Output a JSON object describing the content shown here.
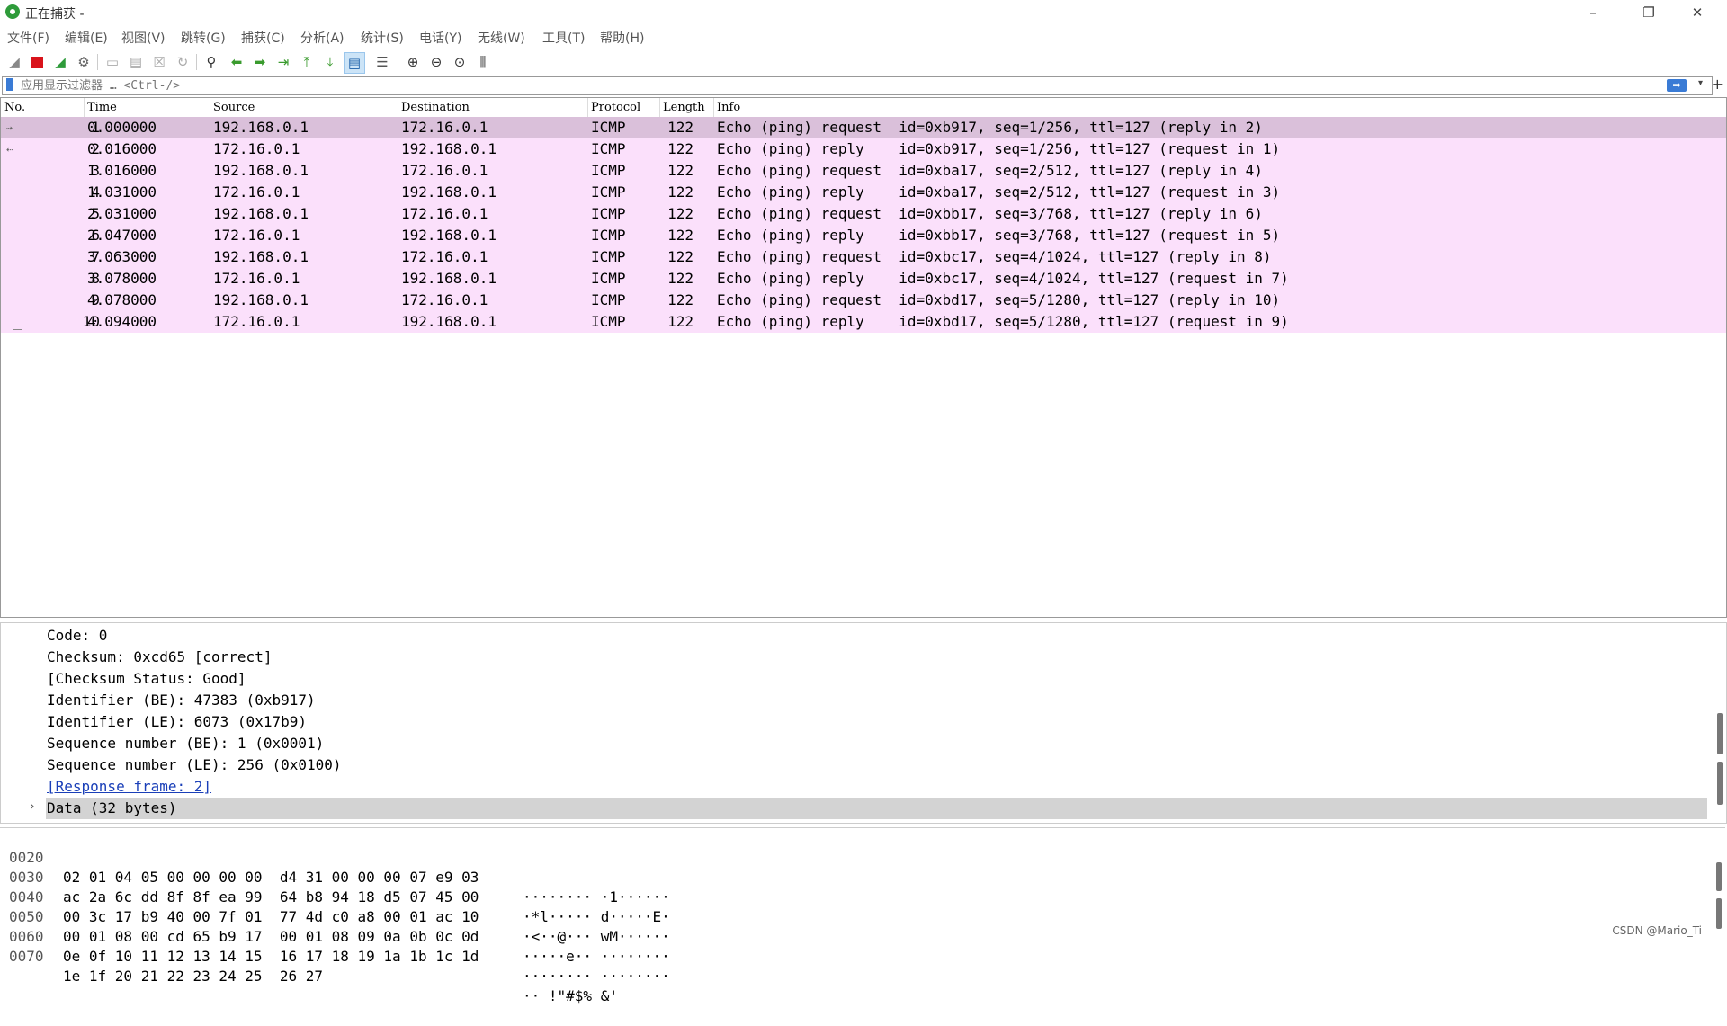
{
  "window": {
    "title": "正在捕获 -",
    "minimize": "–",
    "restore": "❐",
    "close": "✕"
  },
  "menu": [
    "文件(F)",
    "编辑(E)",
    "视图(V)",
    "跳转(G)",
    "捕获(C)",
    "分析(A)",
    "统计(S)",
    "电话(Y)",
    "无线(W)",
    "工具(T)",
    "帮助(H)"
  ],
  "toolbar": {
    "icons": [
      "shark-fin-icon",
      "stop-capture-icon",
      "restart-capture-icon",
      "capture-options-icon",
      "open-file-icon",
      "save-file-icon",
      "close-file-icon",
      "reload-icon",
      "find-packet-icon",
      "go-back-icon",
      "go-forward-icon",
      "go-to-packet-icon",
      "first-packet-icon",
      "last-packet-icon",
      "autoscroll-icon",
      "colorize-icon",
      "zoom-in-icon",
      "zoom-out-icon",
      "normal-size-icon",
      "resize-columns-icon"
    ]
  },
  "filter": {
    "placeholder": "应用显示过滤器 … <Ctrl-/>",
    "apply_glyph": "➡",
    "dropdown_glyph": "▾",
    "add_glyph": "+"
  },
  "packet_list": {
    "columns": [
      "No.",
      "Time",
      "Source",
      "Destination",
      "Protocol",
      "Length",
      "Info"
    ],
    "rows": [
      {
        "no": "1",
        "time": "0.000000",
        "source": "192.168.0.1",
        "destination": "172.16.0.1",
        "protocol": "ICMP",
        "length": "122",
        "info": "Echo (ping) request  id=0xb917, seq=1/256, ttl=127 (reply in 2)",
        "selected": true
      },
      {
        "no": "2",
        "time": "0.016000",
        "source": "172.16.0.1",
        "destination": "192.168.0.1",
        "protocol": "ICMP",
        "length": "122",
        "info": "Echo (ping) reply    id=0xb917, seq=1/256, ttl=127 (request in 1)",
        "selected": false
      },
      {
        "no": "3",
        "time": "1.016000",
        "source": "192.168.0.1",
        "destination": "172.16.0.1",
        "protocol": "ICMP",
        "length": "122",
        "info": "Echo (ping) request  id=0xba17, seq=2/512, ttl=127 (reply in 4)",
        "selected": false
      },
      {
        "no": "4",
        "time": "1.031000",
        "source": "172.16.0.1",
        "destination": "192.168.0.1",
        "protocol": "ICMP",
        "length": "122",
        "info": "Echo (ping) reply    id=0xba17, seq=2/512, ttl=127 (request in 3)",
        "selected": false
      },
      {
        "no": "5",
        "time": "2.031000",
        "source": "192.168.0.1",
        "destination": "172.16.0.1",
        "protocol": "ICMP",
        "length": "122",
        "info": "Echo (ping) request  id=0xbb17, seq=3/768, ttl=127 (reply in 6)",
        "selected": false
      },
      {
        "no": "6",
        "time": "2.047000",
        "source": "172.16.0.1",
        "destination": "192.168.0.1",
        "protocol": "ICMP",
        "length": "122",
        "info": "Echo (ping) reply    id=0xbb17, seq=3/768, ttl=127 (request in 5)",
        "selected": false
      },
      {
        "no": "7",
        "time": "3.063000",
        "source": "192.168.0.1",
        "destination": "172.16.0.1",
        "protocol": "ICMP",
        "length": "122",
        "info": "Echo (ping) request  id=0xbc17, seq=4/1024, ttl=127 (reply in 8)",
        "selected": false
      },
      {
        "no": "8",
        "time": "3.078000",
        "source": "172.16.0.1",
        "destination": "192.168.0.1",
        "protocol": "ICMP",
        "length": "122",
        "info": "Echo (ping) reply    id=0xbc17, seq=4/1024, ttl=127 (request in 7)",
        "selected": false
      },
      {
        "no": "9",
        "time": "4.078000",
        "source": "192.168.0.1",
        "destination": "172.16.0.1",
        "protocol": "ICMP",
        "length": "122",
        "info": "Echo (ping) request  id=0xbd17, seq=5/1280, ttl=127 (reply in 10)",
        "selected": false
      },
      {
        "no": "10",
        "time": "4.094000",
        "source": "172.16.0.1",
        "destination": "192.168.0.1",
        "protocol": "ICMP",
        "length": "122",
        "info": "Echo (ping) reply    id=0xbd17, seq=5/1280, ttl=127 (request in 9)",
        "selected": false
      }
    ]
  },
  "details": {
    "lines": [
      "Code: 0",
      "Checksum: 0xcd65 [correct]",
      "[Checksum Status: Good]",
      "Identifier (BE): 47383 (0xb917)",
      "Identifier (LE): 6073 (0x17b9)",
      "Sequence number (BE): 1 (0x0001)",
      "Sequence number (LE): 256 (0x0100)"
    ],
    "link": "[Response frame: 2]",
    "expand_glyph": "›",
    "data_label": "Data (32 bytes)"
  },
  "bytes": [
    {
      "offset": "0020",
      "hex": "02 01 04 05 00 00 00 00  d4 31 00 00 00 07 e9 03",
      "ascii": "········ ·1······"
    },
    {
      "offset": "0030",
      "hex": "ac 2a 6c dd 8f 8f ea 99  64 b8 94 18 d5 07 45 00",
      "ascii": "·*l····· d·····E·"
    },
    {
      "offset": "0040",
      "hex": "00 3c 17 b9 40 00 7f 01  77 4d c0 a8 00 01 ac 10",
      "ascii": "·<··@··· wM······"
    },
    {
      "offset": "0050",
      "hex": "00 01 08 00 cd 65 b9 17  00 01 08 09 0a 0b 0c 0d",
      "ascii": "·····e·· ········"
    },
    {
      "offset": "0060",
      "hex": "0e 0f 10 11 12 13 14 15  16 17 18 19 1a 1b 1c 1d",
      "ascii": "········ ········"
    },
    {
      "offset": "0070",
      "hex": "1e 1f 20 21 22 23 24 25  26 27",
      "ascii": "·· !\"#$% &'"
    }
  ],
  "watermark": "CSDN @Mario_Ti"
}
